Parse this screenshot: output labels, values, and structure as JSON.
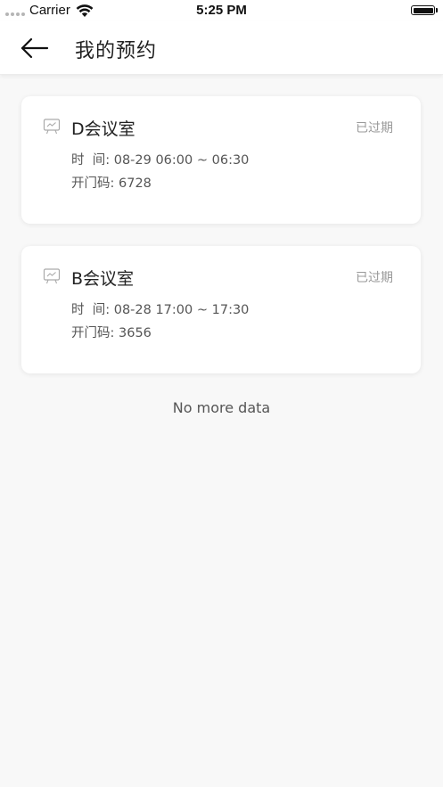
{
  "status_bar": {
    "carrier": "Carrier",
    "time": "5:25 PM"
  },
  "header": {
    "title": "我的预约"
  },
  "reservations": [
    {
      "room": "D会议室",
      "status": "已过期",
      "time_label": "时  间: ",
      "time": "08-29 06:00 ~ 06:30",
      "code_label": "开门码: ",
      "code": "6728"
    },
    {
      "room": "B会议室",
      "status": "已过期",
      "time_label": "时  间: ",
      "time": "08-28 17:00 ~ 17:30",
      "code_label": "开门码: ",
      "code": "3656"
    }
  ],
  "footer_text": "No more data",
  "icons": {
    "back": "back-arrow-icon",
    "room": "meeting-room-screen-icon",
    "wifi": "wifi-icon",
    "battery": "battery-icon"
  },
  "colors": {
    "background": "#f8f8f8",
    "card": "#ffffff",
    "status_text": "#999999"
  }
}
